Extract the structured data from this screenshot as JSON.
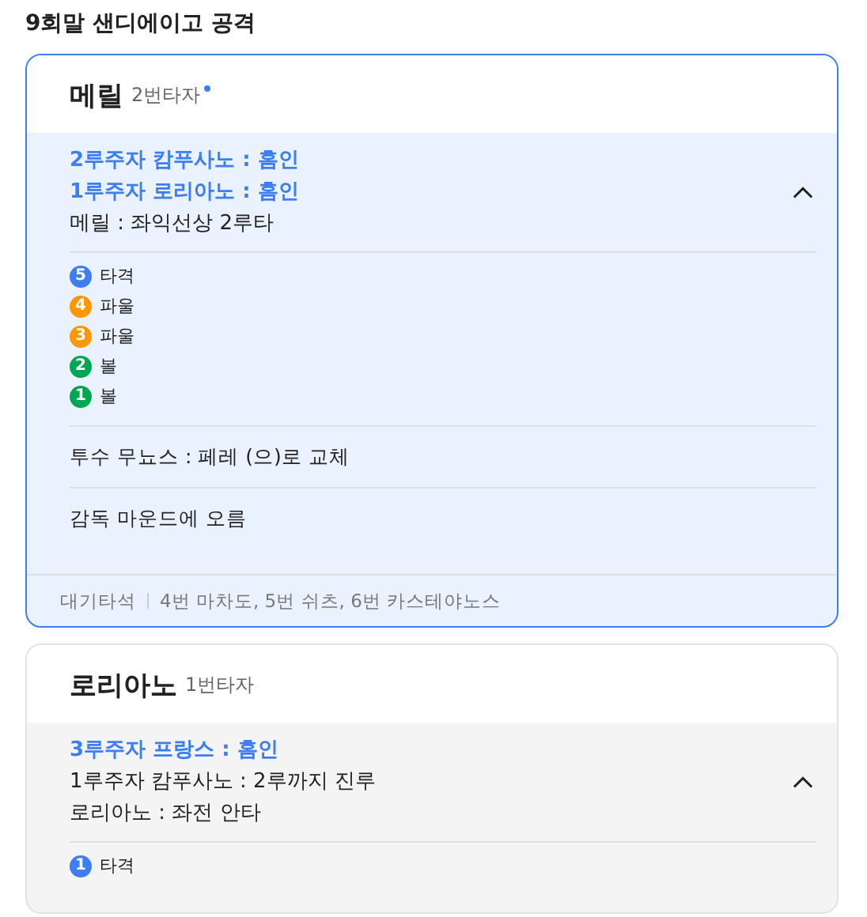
{
  "title": "9회말 샌디에이고 공격",
  "cards": [
    {
      "selected": true,
      "name": "메릴",
      "order": "2번타자",
      "live": true,
      "expanded": true,
      "plays": [
        {
          "kind": "score",
          "text": "2루주자 캄푸사노 : 홈인"
        },
        {
          "kind": "score",
          "text": "1루주자 로리아노 : 홈인"
        },
        {
          "kind": "normal",
          "text": "메릴 : 좌익선상 2루타"
        }
      ],
      "pitches": [
        {
          "number": "5",
          "result": "타격",
          "color": "#3d7ef5"
        },
        {
          "number": "4",
          "result": "파울",
          "color": "#ff9800"
        },
        {
          "number": "3",
          "result": "파울",
          "color": "#ff9800"
        },
        {
          "number": "2",
          "result": "볼",
          "color": "#00a651"
        },
        {
          "number": "1",
          "result": "볼",
          "color": "#00a651"
        }
      ],
      "events": [
        "투수 무뇨스 : 페레 (으)로 교체",
        "감독 마운드에 오름"
      ],
      "bench": {
        "label": "대기타석",
        "text": "4번 마차도, 5번 쉬츠, 6번 카스테야노스"
      }
    },
    {
      "selected": false,
      "name": "로리아노",
      "order": "1번타자",
      "live": false,
      "expanded": true,
      "plays": [
        {
          "kind": "score",
          "text": "3루주자 프랑스 : 홈인"
        },
        {
          "kind": "normal",
          "text": "1루주자 캄푸사노 : 2루까지 진루"
        },
        {
          "kind": "normal",
          "text": "로리아노 : 좌전 안타"
        }
      ],
      "pitches": [
        {
          "number": "1",
          "result": "타격",
          "color": "#3d7ef5"
        }
      ]
    }
  ]
}
